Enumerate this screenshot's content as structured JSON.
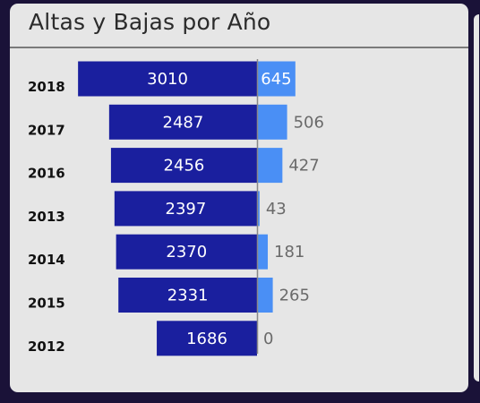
{
  "card": {
    "title": "Altas y Bajas por Año"
  },
  "colors": {
    "background": "#1a1238",
    "card": "#e6e6e6",
    "altas": "#1a1f9e",
    "bajas": "#4a8ff5",
    "axis": "#888888",
    "label_outside": "#6a6a6a",
    "label_inside": "#ffffff",
    "category_text": "#111111"
  },
  "chart_data": {
    "type": "bar",
    "orientation": "horizontal-diverging",
    "title": "Altas y Bajas por Año",
    "categories": [
      "2018",
      "2017",
      "2016",
      "2013",
      "2014",
      "2015",
      "2012"
    ],
    "series": [
      {
        "values": [
          3010,
          2487,
          2456,
          2397,
          2370,
          2331,
          1686
        ]
      },
      {
        "values": [
          645,
          506,
          427,
          43,
          181,
          265,
          0
        ]
      }
    ]
  }
}
